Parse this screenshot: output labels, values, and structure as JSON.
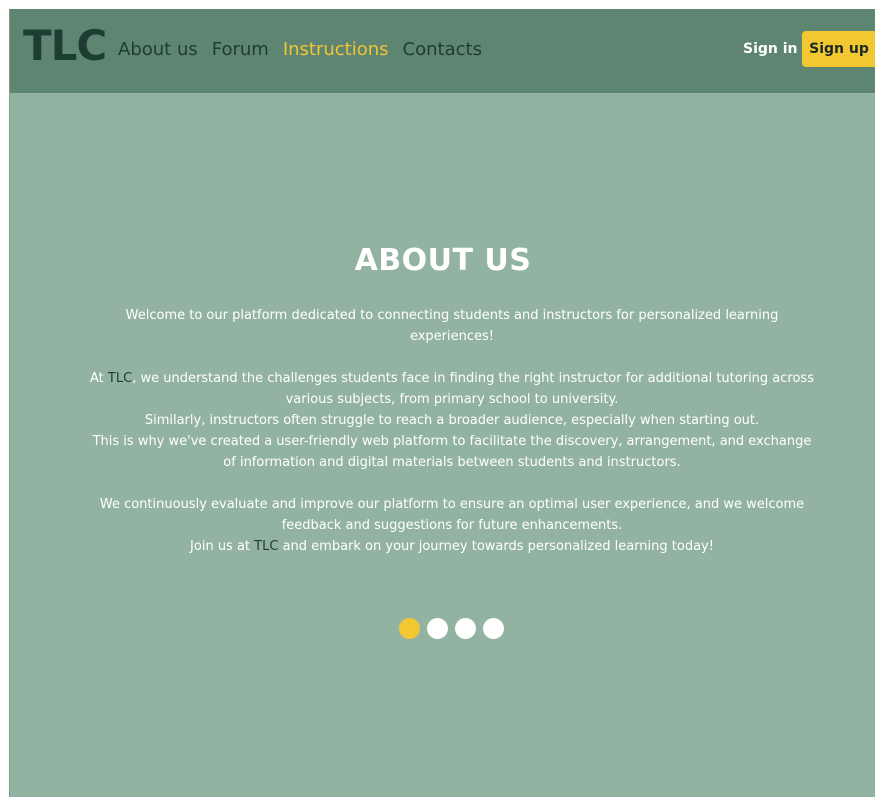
{
  "nav": {
    "logo": "TLC",
    "links": [
      {
        "label": "About us"
      },
      {
        "label": "Forum"
      },
      {
        "label": "Instructions"
      },
      {
        "label": "Contacts"
      }
    ],
    "active_link": "Instructions",
    "signin_label": "Sign in",
    "signup_label": "Sign up"
  },
  "main": {
    "heading": "ABOUT US",
    "p1": "Welcome to our platform dedicated to connecting students and instructors for personalized learning experiences!",
    "p2_pre": "At ",
    "brand": "TLC",
    "p2_post": ", we understand the challenges students face in finding the right instructor for additional tutoring across various subjects, from primary school to university.",
    "p2_line2": "Similarly, instructors often struggle to reach a broader audience, especially when starting out.",
    "p2_line3": "This is why we've created a user-friendly web platform to facilitate the discovery, arrangement, and exchange of information and digital materials between students and instructors.",
    "p3_line1": "We continuously evaluate and improve our platform to ensure an optimal user experience, and we welcome feedback and suggestions for future enhancements.",
    "p3_pre": "Join us at ",
    "p3_post": " and embark on your journey towards personalized learning today!"
  },
  "carousel": {
    "count": 4,
    "active_index": 0
  },
  "colors": {
    "navbar_bg": "#5e8572",
    "page_bg": "#93b3a2",
    "accent": "#f2c832",
    "dark_text": "#1f3b32"
  }
}
